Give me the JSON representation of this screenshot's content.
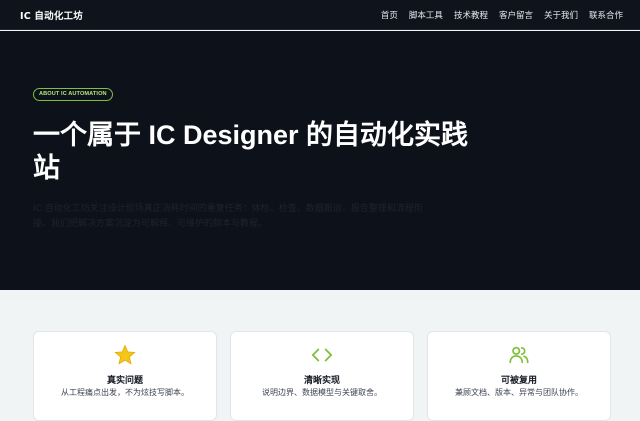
{
  "header": {
    "brand": "IC 自动化工坊",
    "nav": [
      "首页",
      "脚本工具",
      "技术教程",
      "客户留言",
      "关于我们",
      "联系合作"
    ]
  },
  "hero": {
    "badge": "ABOUT IC AUTOMATION",
    "title": "一个属于 IC Designer 的自动化实践站",
    "description": "IC 自动化工坊关注设计现场真正消耗时间的重复任务：体检、检查、数据搬运、报告整理和流程衔接。我们把解决方案沉淀为可解释、可维护的脚本与教程。"
  },
  "cards": [
    {
      "icon": "star-icon",
      "title": "真实问题",
      "subtitle": "从工程痛点出发，不为炫技写脚本。"
    },
    {
      "icon": "code-icon",
      "title": "清晰实现",
      "subtitle": "说明边界、数据模型与关键取舍。"
    },
    {
      "icon": "users-icon",
      "title": "可被复用",
      "subtitle": "兼顾文档、版本、异常与团队协作。"
    }
  ],
  "colors": {
    "accent_green": "#7fbf3a",
    "star_yellow": "#f5c518",
    "hero_bg": "#0d121a"
  }
}
